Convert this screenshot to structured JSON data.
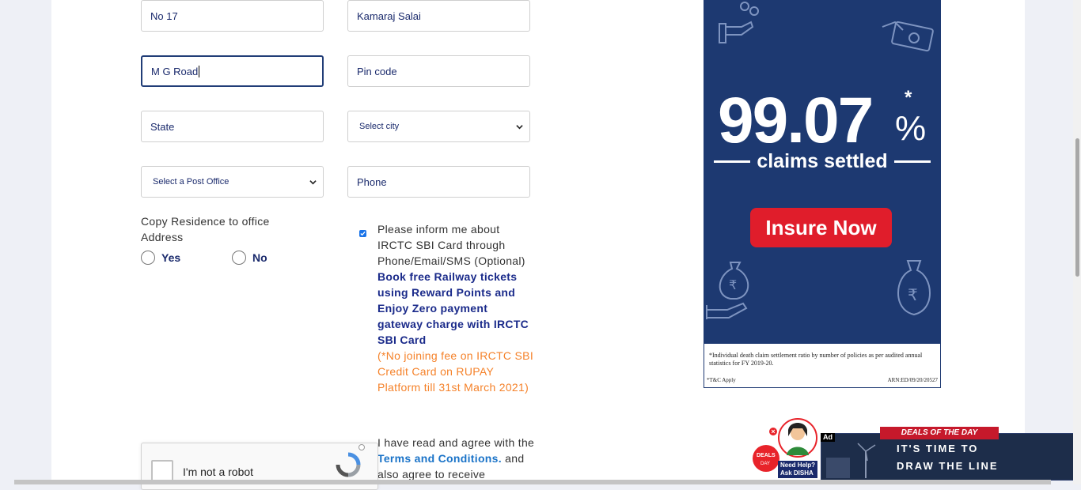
{
  "form": {
    "house_no": "No 17",
    "street": "Kamaraj Salai",
    "area": "M G Road",
    "pincode_placeholder": "Pin code",
    "state_placeholder": "State",
    "city_select": "Select city",
    "post_office_select": "Select a Post Office",
    "phone_placeholder": "Phone",
    "copy_label": "Copy Residence to office Address",
    "yes_label": "Yes",
    "no_label": "No"
  },
  "consent": {
    "inform_text": "Please inform me about IRCTC SBI Card through Phone/Email/SMS (Optional)",
    "reward_text": "Book free Railway tickets using Reward Points and Enjoy Zero payment gateway charge with IRCTC SBI Card",
    "fee_text": "(*No joining fee on IRCTC SBI Credit Card on RUPAY Platform till 31st March 2021)",
    "agree_prefix": "I have read and agree with the",
    "terms_link": "Terms and Conditions.",
    "agree_suffix": "and also agree to receive"
  },
  "recaptcha": {
    "label": "I'm not a robot"
  },
  "ad": {
    "big_number": "99.07",
    "percent": "%",
    "star": "*",
    "claims": "claims settled",
    "cta": "Insure Now",
    "note": "*Individual death claim settlement ratio by number of policies as per audited annual statistics for FY 2019-20.",
    "tc": "*T&C Apply",
    "arn": "ARN:ED/09/20/20527"
  },
  "bottom_ads": {
    "disha_text_1": "Need Help?",
    "disha_text_2": "Ask DISHA",
    "ad_mark": "Ad",
    "ribbon": "DEALS OF THE DAY",
    "line1": "IT'S TIME TO",
    "line2": "DRAW THE LINE"
  },
  "colors": {
    "navy": "#1a2a6c",
    "ad_bg": "#1d3971",
    "cta_red": "#e01d2b",
    "orange": "#f5822a"
  }
}
